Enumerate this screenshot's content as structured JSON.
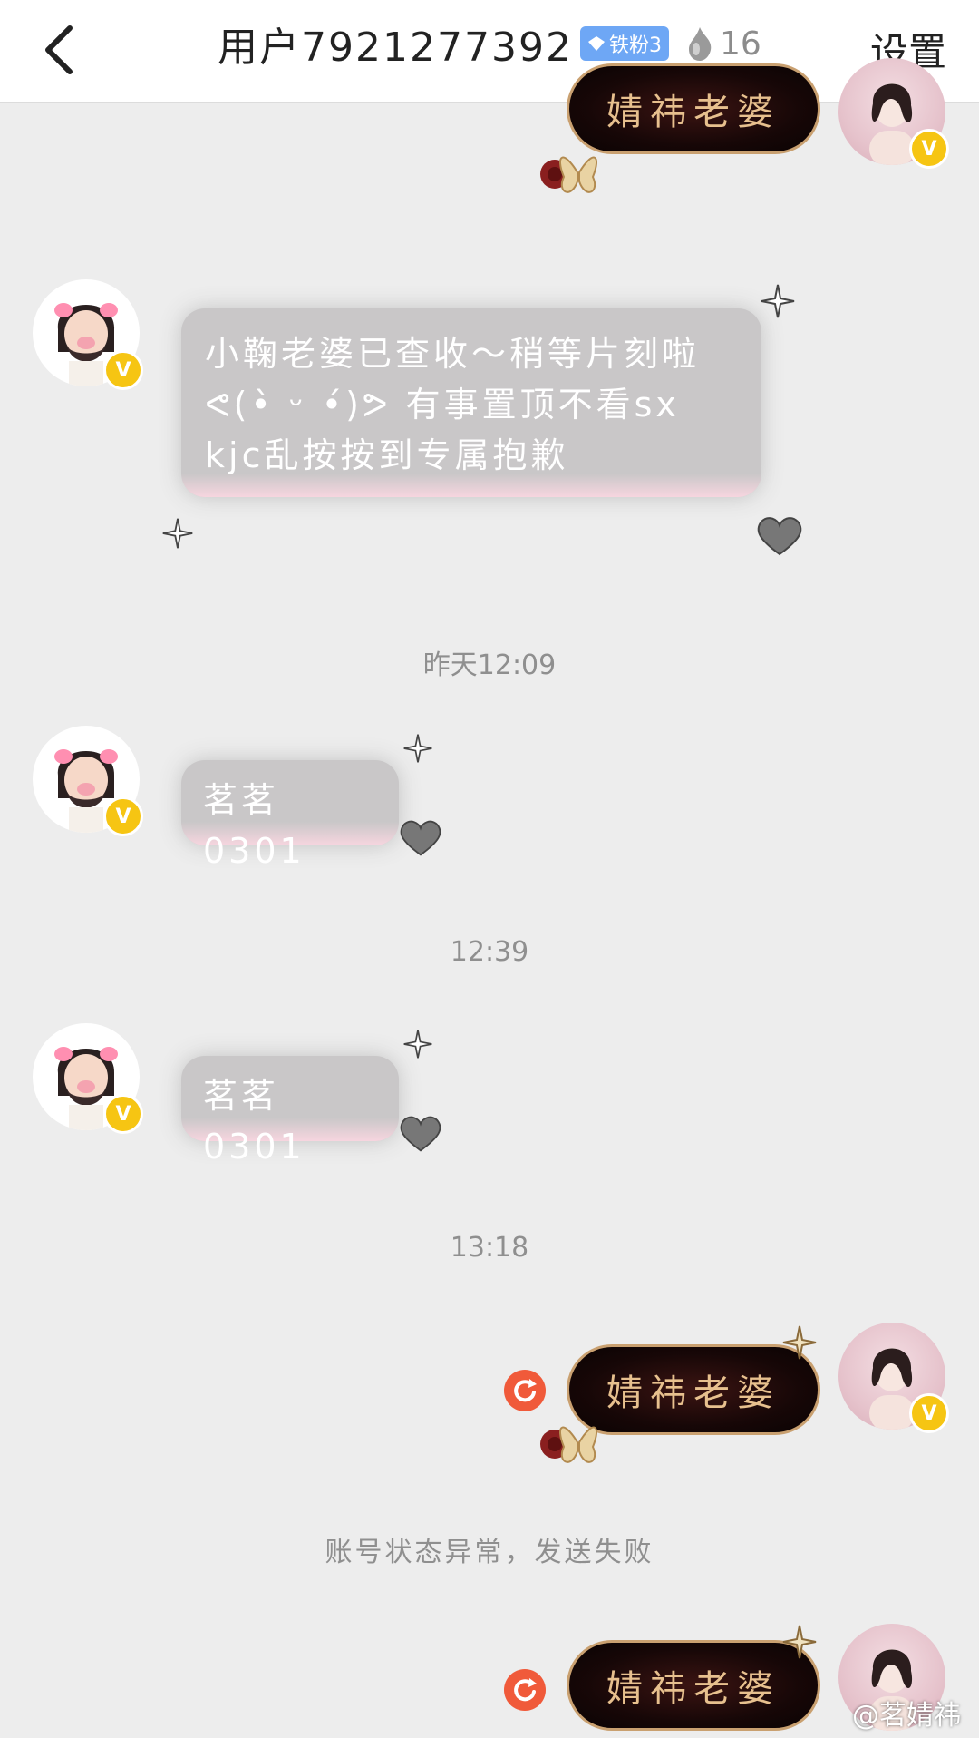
{
  "header": {
    "title": "用户7921277392",
    "fan_badge": "铁粉3",
    "heat_count": "16",
    "settings_label": "设置"
  },
  "messages": {
    "m1_text": "婧祎老婆",
    "m2_text": "小鞠老婆已查收～稍等片刻啦ᕙ(•̀ ᵕ •́)ᕗ 有事置顶不看sx kjc乱按按到专属抱歉",
    "m3_text": "茗茗0301",
    "m4_text": "茗茗0301",
    "m5_text": "婧祎老婆",
    "m6_text": "婧祎老婆"
  },
  "timestamps": {
    "t1": "昨天12:09",
    "t2": "12:39",
    "t3": "13:18"
  },
  "notice": "账号状态异常，发送失败",
  "watermark": "@茗婧祎",
  "colors": {
    "bg": "#ededed",
    "left_bubble": "#c9c7c8",
    "right_bubble": "#170707",
    "right_text": "#e7c08e",
    "resend": "#f05a3a",
    "v_badge": "#f6c513"
  }
}
